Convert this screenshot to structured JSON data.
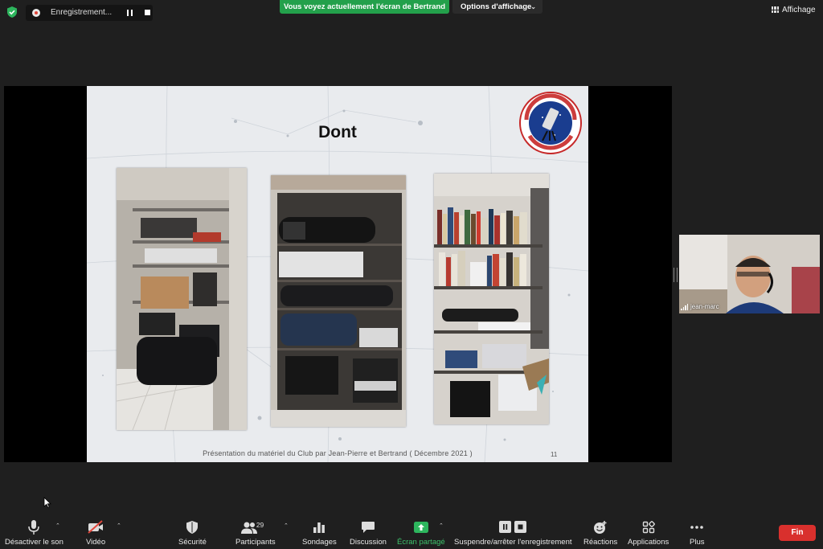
{
  "top": {
    "recording_label": "Enregistrement...",
    "share_banner": "Vous voyez actuellement l'écran de Bertrand",
    "view_options_label": "Options d'affichage",
    "view_button_label": "Affichage"
  },
  "slide": {
    "title": "Dont",
    "footer": "Présentation du matériel du Club par Jean-Pierre et Bertrand ( Décembre 2021 )",
    "page_number": "11",
    "logo_text_top": "CLUB D'ASTRONOMIE",
    "logo_text_bottom": "D'ANTONY"
  },
  "participant": {
    "name": "jean-marc"
  },
  "toolbar": {
    "mute_label": "Désactiver le son",
    "video_label": "Vidéo",
    "security_label": "Sécurité",
    "participants_label": "Participants",
    "participants_count": "29",
    "polls_label": "Sondages",
    "chat_label": "Discussion",
    "share_label": "Écran partagé",
    "record_label": "Suspendre/arrêter l'enregistrement",
    "reactions_label": "Réactions",
    "apps_label": "Applications",
    "more_label": "Plus",
    "end_label": "Fin"
  },
  "colors": {
    "share_green": "#23a04b",
    "end_red": "#d9302d",
    "background": "#1f1f1f"
  }
}
